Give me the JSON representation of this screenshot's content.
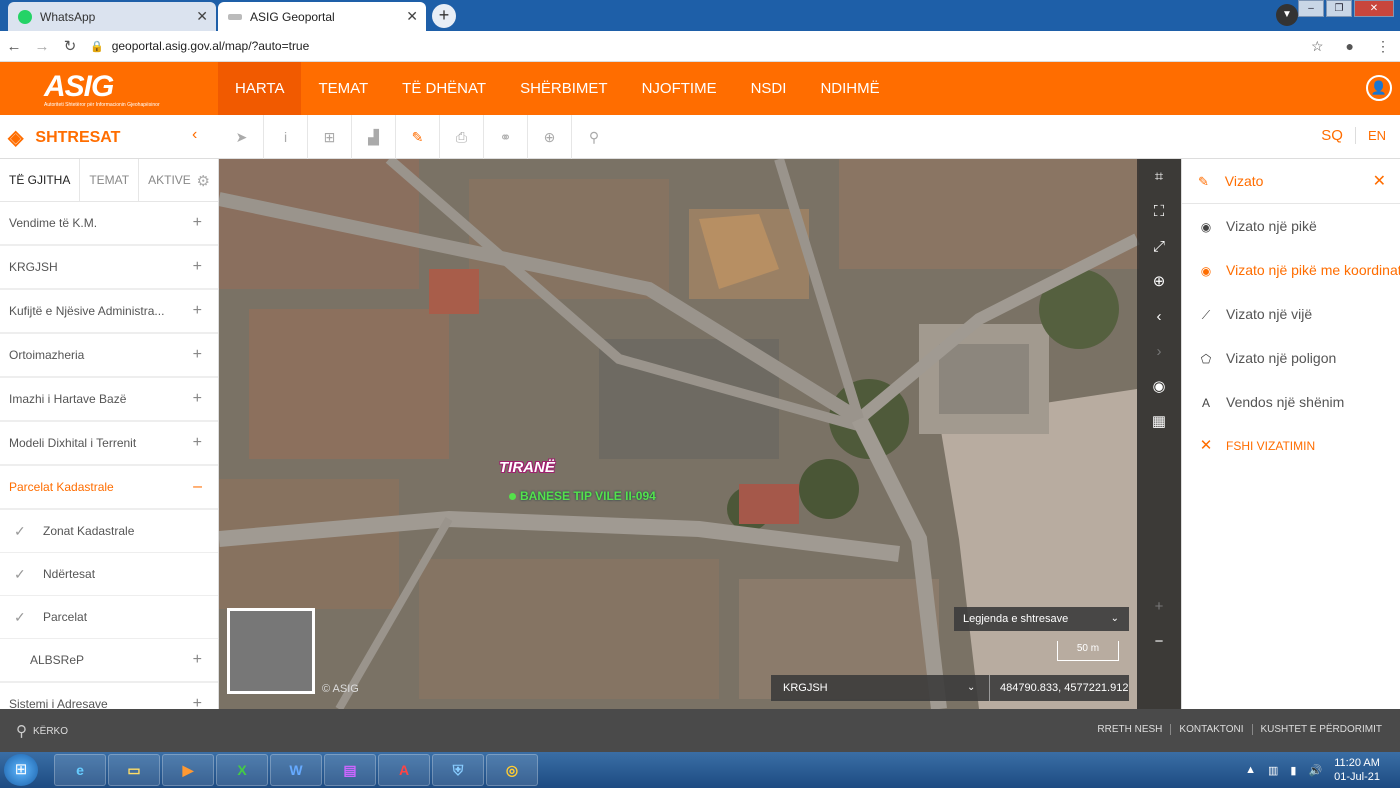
{
  "browser": {
    "tabs": [
      {
        "title": "WhatsApp",
        "active": false
      },
      {
        "title": "ASIG Geoportal",
        "active": true
      }
    ],
    "url": "geoportal.asig.gov.al/map/?auto=true"
  },
  "header": {
    "logo_text": "ASIG",
    "logo_subtext": "Autoriteti Shtetëror për Informacionin Gjeohapësinor",
    "menu": [
      "HARTA",
      "TEMAT",
      "TË DHËNAT",
      "SHËRBIMET",
      "NJOFTIME",
      "NSDI",
      "NDIHMË"
    ],
    "active_menu": "HARTA"
  },
  "toolbar": {
    "layers_title": "SHTRESAT",
    "lang_sq": "SQ",
    "lang_en": "EN"
  },
  "sidebar": {
    "tabs": [
      "TË GJITHA",
      "TEMAT",
      "AKTIVE"
    ],
    "items": [
      {
        "label": "Vendime të K.M."
      },
      {
        "label": "KRGJSH"
      },
      {
        "label": "Kufijtë e Njësive Administra..."
      },
      {
        "label": "Ortoimazheria"
      },
      {
        "label": "Imazhi i Hartave Bazë"
      },
      {
        "label": "Modeli Dixhital i Terrenit"
      },
      {
        "label": "Parcelat Kadastrale"
      }
    ],
    "subitems": [
      {
        "label": "Zonat Kadastrale"
      },
      {
        "label": "Ndërtesat"
      },
      {
        "label": "Parcelat"
      }
    ],
    "more_items": [
      {
        "label": "ALBSReP"
      },
      {
        "label": "Sistemi i Adresave"
      }
    ]
  },
  "map": {
    "city_label": "TIRANË",
    "poi_label": "BANESE TIP VILE II-094",
    "copyright": "© ASIG",
    "legend_label": "Legjenda e shtresave",
    "scale": "50 m",
    "projection": "KRGJSH",
    "coordinates": "484790.833, 4577221.912"
  },
  "drawpanel": {
    "title": "Vizato",
    "items": [
      {
        "label": "Vizato një pikë",
        "icon": "point-icon",
        "highlight": false
      },
      {
        "label": "Vizato një pikë me koordinata",
        "icon": "point-coord-icon",
        "highlight": true
      },
      {
        "label": "Vizato një vijë",
        "icon": "line-icon",
        "highlight": false
      },
      {
        "label": "Vizato një poligon",
        "icon": "polygon-icon",
        "highlight": false
      },
      {
        "label": "Vendos një shënim",
        "icon": "text-icon",
        "highlight": false
      }
    ],
    "delete_label": "FSHI VIZATIMIN"
  },
  "footer": {
    "search": "KËRKO",
    "links": [
      "RRETH NESH",
      "KONTAKTONI",
      "KUSHTET E PËRDORIMIT"
    ]
  },
  "taskbar": {
    "time": "11:20 AM",
    "date": "01-Jul-21"
  },
  "colors": {
    "accent": "#ff6d00",
    "header_active": "#f15a00",
    "footer": "#4a4a4a"
  }
}
